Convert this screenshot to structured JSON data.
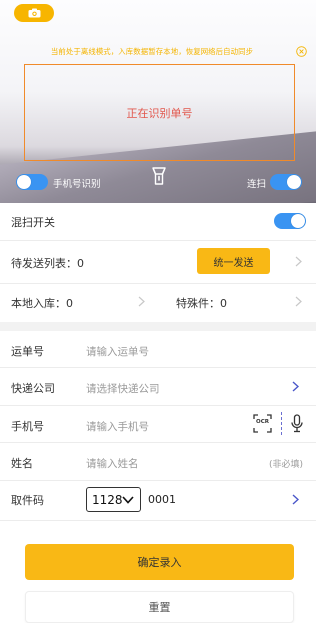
{
  "camera": {
    "offline_notice": "当前处于离线模式，入库数据暂存本地，恢复网络后自动同步",
    "scan_status": "正在识别单号",
    "phone_recognition_label": "手机号识别",
    "phone_recognition_on": true,
    "continuous_scan_label": "连扫",
    "continuous_scan_on": true
  },
  "settings": {
    "mixed_scan_label": "混扫开关",
    "mixed_scan_on": true
  },
  "pending": {
    "label": "待发送列表：0",
    "send_button": "统一发送"
  },
  "stats": {
    "local_inbound": "本地入库：0",
    "special_items": "特殊件：0"
  },
  "form": {
    "waybill_label": "运单号",
    "waybill_placeholder": "请输入运单号",
    "courier_label": "快递公司",
    "courier_placeholder": "请选择快递公司",
    "phone_label": "手机号",
    "phone_placeholder": "请输入手机号",
    "ocr_icon_text": "OCR",
    "name_label": "姓名",
    "name_placeholder": "请输入姓名",
    "name_optional": "(非必填)",
    "pickup_label": "取件码",
    "pickup_prefix": "1128",
    "pickup_number": "0001"
  },
  "actions": {
    "confirm": "确定录入",
    "reset": "重置"
  },
  "colors": {
    "accent": "#f9b815",
    "toggle": "#3a94f2",
    "scan_box": "#f08a2a",
    "scan_text": "#e2564c",
    "notice": "#f4b400",
    "chevron_active": "#4a57c9"
  }
}
